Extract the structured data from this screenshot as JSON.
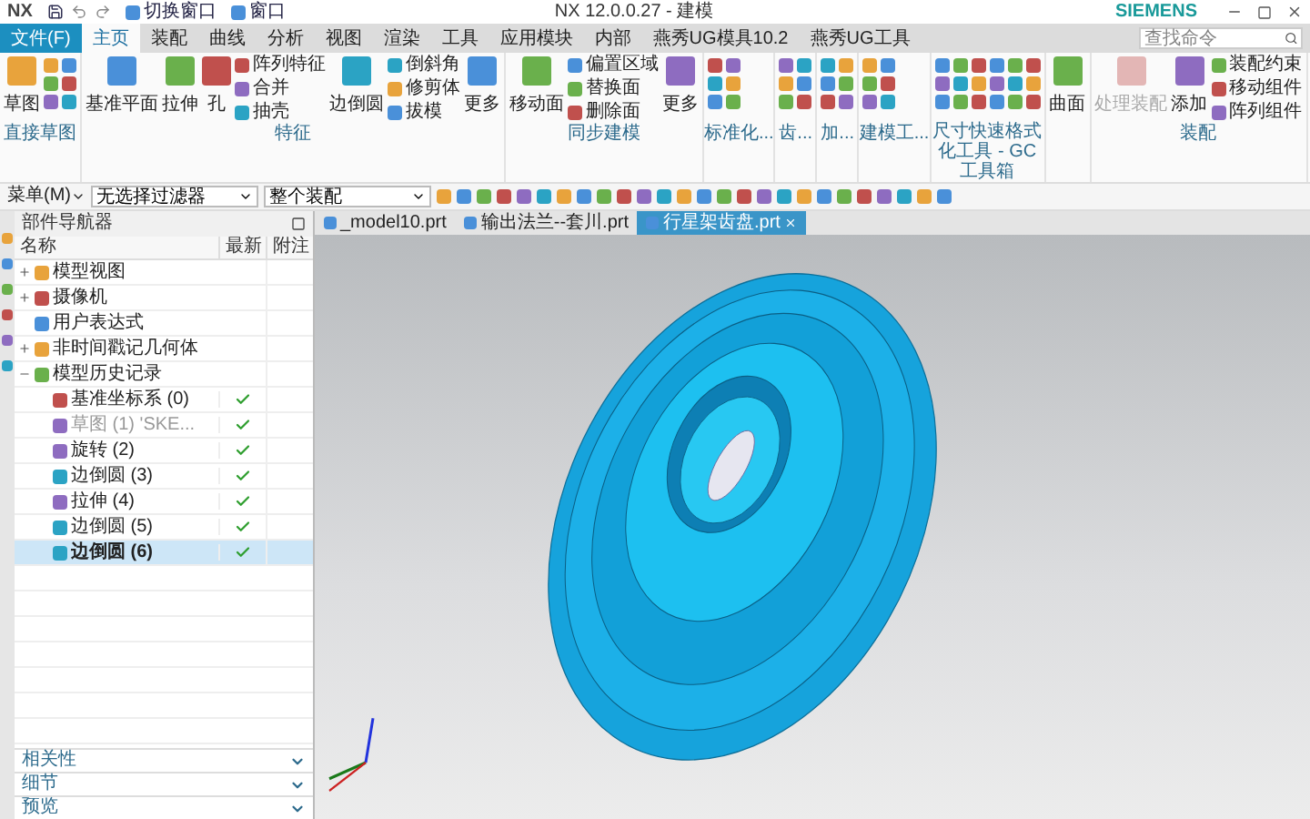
{
  "window": {
    "logo": "NX",
    "title": "NX 12.0.0.27 - 建模",
    "brand": "SIEMENS"
  },
  "quick_access": [
    {
      "label": "切换窗口"
    },
    {
      "label": "窗口"
    }
  ],
  "menu_tabs": [
    {
      "label": "文件(F)",
      "kind": "file",
      "selected": false
    },
    {
      "label": "主页",
      "kind": "tab",
      "selected": true
    },
    {
      "label": "装配",
      "kind": "tab",
      "selected": false
    },
    {
      "label": "曲线",
      "kind": "tab",
      "selected": false
    },
    {
      "label": "分析",
      "kind": "tab",
      "selected": false
    },
    {
      "label": "视图",
      "kind": "tab",
      "selected": false
    },
    {
      "label": "渲染",
      "kind": "tab",
      "selected": false
    },
    {
      "label": "工具",
      "kind": "tab",
      "selected": false
    },
    {
      "label": "应用模块",
      "kind": "tab",
      "selected": false
    },
    {
      "label": "内部",
      "kind": "tab",
      "selected": false
    },
    {
      "label": "燕秀UG模具10.2",
      "kind": "tab",
      "selected": false
    },
    {
      "label": "燕秀UG工具",
      "kind": "tab",
      "selected": false
    }
  ],
  "search": {
    "placeholder": "查找命令"
  },
  "ribbon_groups": [
    {
      "label": "直接草图",
      "columns": [
        {
          "kind": "big",
          "label": "草图",
          "disabled": false
        },
        {
          "kind": "icons"
        }
      ]
    },
    {
      "label": "特征",
      "columns": [
        {
          "kind": "big",
          "label": "基准平面",
          "disabled": false
        },
        {
          "kind": "big",
          "label": "拉伸",
          "disabled": false
        },
        {
          "kind": "big",
          "label": "孔",
          "disabled": false
        },
        {
          "kind": "small",
          "items": [
            "阵列特征",
            "合并",
            "抽壳"
          ]
        },
        {
          "kind": "big",
          "label": "边倒圆",
          "disabled": false
        },
        {
          "kind": "small",
          "items": [
            "倒斜角",
            "修剪体",
            "拔模"
          ]
        },
        {
          "kind": "big",
          "label": "更多",
          "disabled": false
        }
      ]
    },
    {
      "label": "同步建模",
      "columns": [
        {
          "kind": "big",
          "label": "移动面",
          "disabled": false
        },
        {
          "kind": "small",
          "items": [
            "偏置区域",
            "替换面",
            "删除面"
          ]
        },
        {
          "kind": "big",
          "label": "更多",
          "disabled": false
        }
      ]
    },
    {
      "label": "标准化...",
      "columns": [
        {
          "kind": "icons"
        }
      ]
    },
    {
      "label": "齿...",
      "columns": [
        {
          "kind": "icons"
        }
      ]
    },
    {
      "label": "加...",
      "columns": [
        {
          "kind": "icons"
        }
      ]
    },
    {
      "label": "建模工...",
      "columns": [
        {
          "kind": "icons"
        }
      ]
    },
    {
      "label": "尺寸快速格式化工具 - GC工具箱",
      "columns": [
        {
          "kind": "icons"
        },
        {
          "kind": "icons"
        }
      ]
    },
    {
      "columns": [
        {
          "kind": "big",
          "label": "曲面",
          "disabled": false
        }
      ]
    },
    {
      "label": "装配",
      "columns": [
        {
          "kind": "big",
          "label": "处理装配",
          "disabled": true
        },
        {
          "kind": "big",
          "label": "添加",
          "disabled": false
        },
        {
          "kind": "small",
          "items": [
            "装配约束",
            "移动组件",
            "阵列组件"
          ]
        }
      ]
    }
  ],
  "toolbar": {
    "menu_button": "菜单(M)",
    "filters": [
      {
        "value": "无选择过滤器"
      },
      {
        "value": "整个装配"
      }
    ]
  },
  "file_tabs": [
    {
      "label": "_model10.prt",
      "selected": false,
      "closable": false
    },
    {
      "label": "输出法兰--套川.prt",
      "selected": false,
      "closable": false
    },
    {
      "label": "行星架齿盘.prt",
      "selected": true,
      "closable": true
    }
  ],
  "navigator": {
    "title": "部件导航器",
    "columns": [
      "名称",
      "最新",
      "附注"
    ],
    "nodes": [
      {
        "label": "模型视图",
        "expanded": false,
        "dimmed": false,
        "selected": false
      },
      {
        "label": "摄像机",
        "expanded": false,
        "dimmed": false,
        "selected": false
      },
      {
        "label": "用户表达式",
        "dimmed": false,
        "selected": false
      },
      {
        "label": "非时间戳记几何体",
        "expanded": false,
        "dimmed": false,
        "selected": false
      },
      {
        "label": "模型历史记录",
        "expanded": true,
        "dimmed": false,
        "selected": false,
        "children": [
          {
            "label": "基准坐标系 (0)",
            "latest": true,
            "dimmed": false,
            "selected": false
          },
          {
            "label": "草图 (1) 'SKE...",
            "latest": true,
            "dimmed": true,
            "selected": false
          },
          {
            "label": "旋转 (2)",
            "latest": true,
            "dimmed": false,
            "selected": false
          },
          {
            "label": "边倒圆 (3)",
            "latest": true,
            "dimmed": false,
            "selected": false
          },
          {
            "label": "拉伸 (4)",
            "latest": true,
            "dimmed": false,
            "selected": false
          },
          {
            "label": "边倒圆 (5)",
            "latest": true,
            "dimmed": false,
            "selected": false
          },
          {
            "label": "边倒圆 (6)",
            "latest": true,
            "dimmed": false,
            "selected": true
          }
        ]
      }
    ]
  },
  "bottom_panels": [
    {
      "label": "相关性",
      "expanded": false
    },
    {
      "label": "细节",
      "expanded": false
    },
    {
      "label": "预览",
      "expanded": false
    }
  ]
}
